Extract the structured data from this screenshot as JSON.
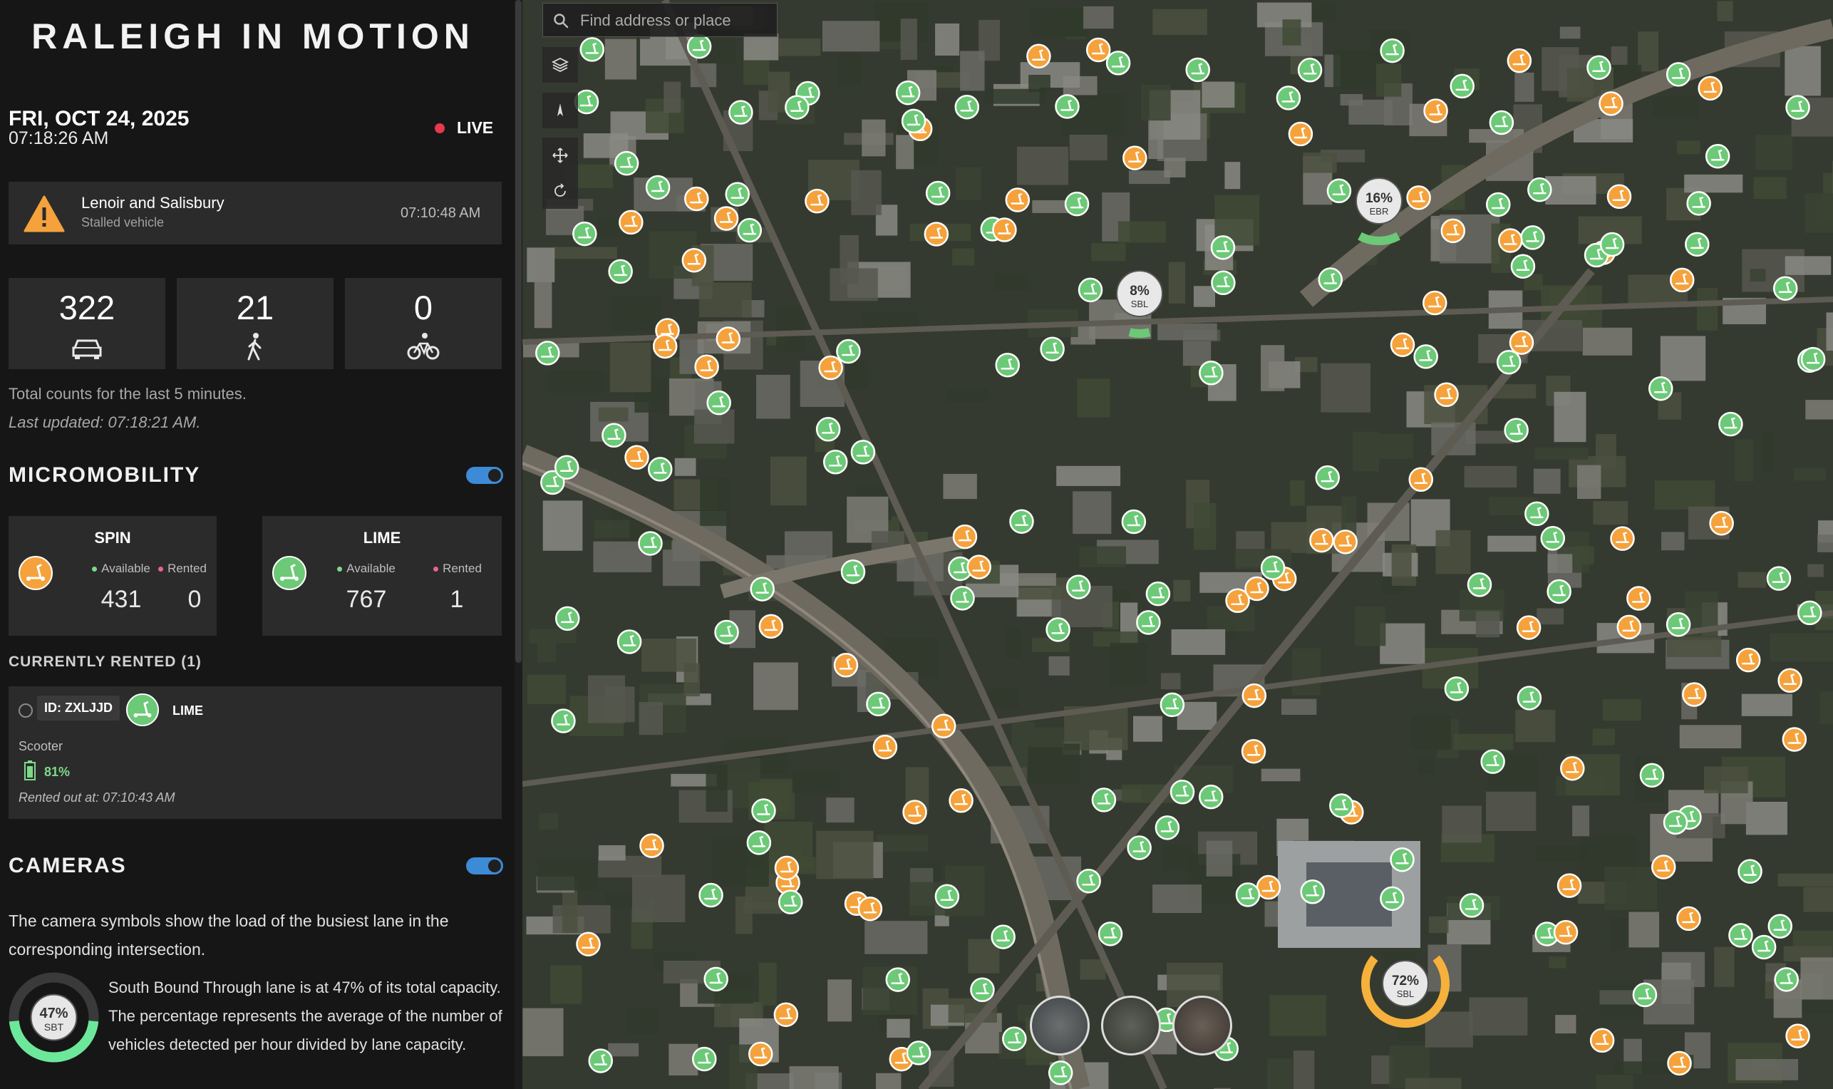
{
  "header": {
    "title": "RALEIGH IN MOTION",
    "date": "FRI, OCT 24, 2025",
    "time": "07:18:26 AM",
    "live_label": "LIVE"
  },
  "alert": {
    "location": "Lenoir and Salisbury",
    "type": "Stalled vehicle",
    "time": "07:10:48 AM",
    "icon": "warning-triangle-icon"
  },
  "counts": [
    {
      "value": "322",
      "icon": "car-icon"
    },
    {
      "value": "21",
      "icon": "pedestrian-icon"
    },
    {
      "value": "0",
      "icon": "bicycle-icon"
    }
  ],
  "counts_note": "Total counts for the last 5 minutes.",
  "last_updated": "Last updated: 07:18:21 AM.",
  "micromobility": {
    "heading": "MICROMOBILITY",
    "toggle_on": true,
    "vendors": [
      {
        "name": "SPIN",
        "color": "#f5a23c",
        "available_label": "Available",
        "rented_label": "Rented",
        "available": "431",
        "rented": "0"
      },
      {
        "name": "LIME",
        "color": "#6cc977",
        "available_label": "Available",
        "rented_label": "Rented",
        "available": "767",
        "rented": "1"
      }
    ]
  },
  "currently_rented": {
    "heading": "CURRENTLY RENTED (1)",
    "item": {
      "id": "ID: ZXLJJD",
      "vendor": "LIME",
      "type": "Scooter",
      "battery": "81%",
      "rented_at": "Rented out at: 07:10:43 AM"
    }
  },
  "cameras": {
    "heading": "CAMERAS",
    "toggle_on": true,
    "description": "The camera symbols show the load of the busiest lane in the corresponding intersection.",
    "gauge": {
      "percent": "47%",
      "lane": "SBT",
      "fraction": 0.47
    },
    "gauge_text": "South Bound Through lane is at 47% of its total capacity. The percentage represents the average of the number of vehicles detected per hour divided by lane capacity."
  },
  "map": {
    "search_placeholder": "Find address or place",
    "tools": [
      "layers-icon",
      "compass-icon",
      "pan-icon",
      "rotate-icon"
    ],
    "gauges": [
      {
        "percent": "16%",
        "lane": "EBR",
        "fraction": 0.16,
        "color": "#6cc977"
      },
      {
        "percent": "8%",
        "lane": "SBL",
        "fraction": 0.08,
        "color": "#6cc977"
      },
      {
        "percent": "72%",
        "lane": "SBL",
        "fraction": 0.72,
        "color": "#f5b13c"
      }
    ],
    "basemaps": [
      "basemap-imagery",
      "basemap-streets",
      "basemap-hybrid"
    ]
  }
}
